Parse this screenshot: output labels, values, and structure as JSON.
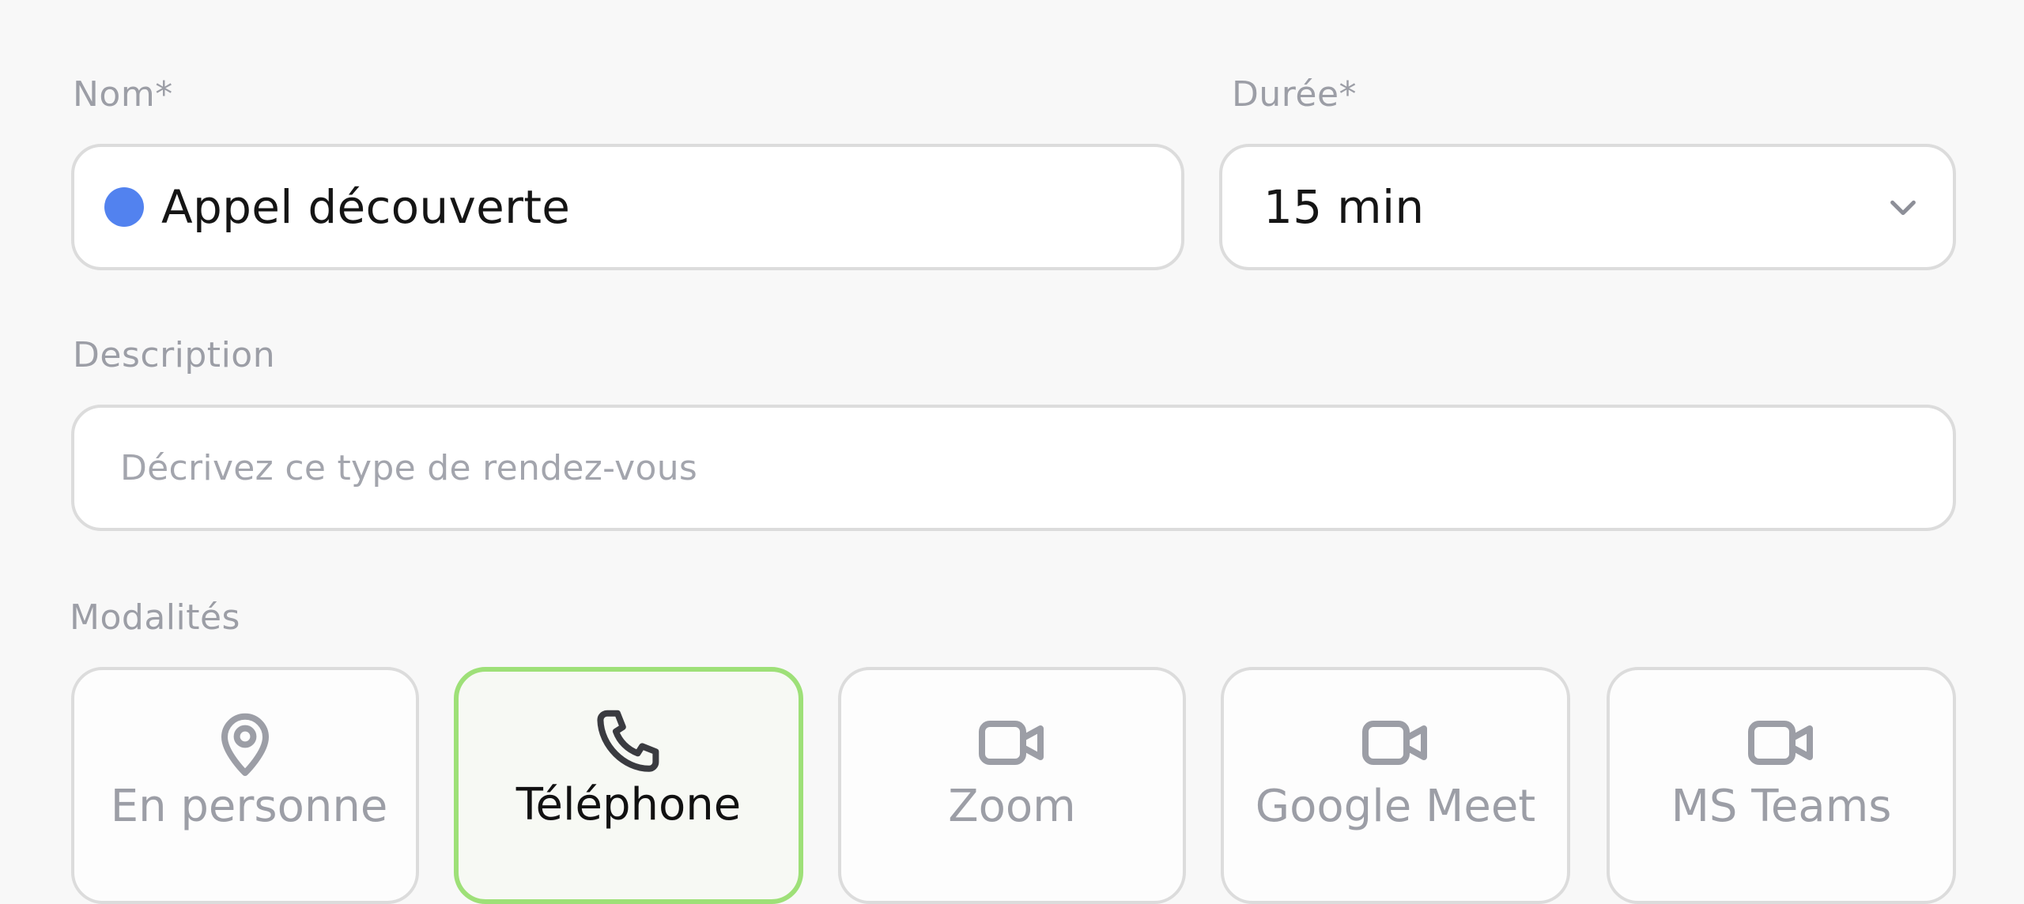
{
  "form": {
    "name": {
      "label": "Nom*",
      "value": "Appel découverte",
      "color": "#5282ef"
    },
    "duration": {
      "label": "Durée*",
      "value": "15 min"
    },
    "description": {
      "label": "Description",
      "placeholder": "Décrivez ce type de rendez-vous"
    },
    "modalities": {
      "label": "Modalités",
      "options": [
        {
          "label": "En personne",
          "icon": "map-pin-icon",
          "selected": false
        },
        {
          "label": "Téléphone",
          "icon": "phone-icon",
          "selected": true
        },
        {
          "label": "Zoom",
          "icon": "video-camera-icon",
          "selected": false
        },
        {
          "label": "Google Meet",
          "icon": "video-camera-icon",
          "selected": false
        },
        {
          "label": "MS Teams",
          "icon": "video-camera-icon",
          "selected": false
        }
      ]
    }
  },
  "colors": {
    "selected_border": "#9ee078",
    "field_border": "#dcdcdc",
    "label_gray": "#9c9ea6"
  }
}
